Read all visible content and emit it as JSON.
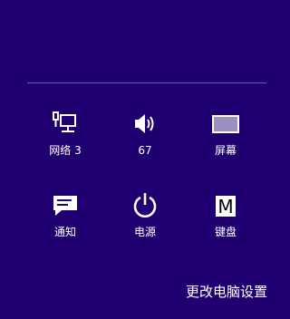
{
  "settings_panel": {
    "tiles": [
      {
        "name": "network",
        "label": "网络 3",
        "icon": "network-icon"
      },
      {
        "name": "volume",
        "label": "67",
        "icon": "speaker-icon"
      },
      {
        "name": "screen",
        "label": "屏幕",
        "icon": "screen-icon"
      },
      {
        "name": "notifications",
        "label": "通知",
        "icon": "notifications-icon"
      },
      {
        "name": "power",
        "label": "电源",
        "icon": "power-icon"
      },
      {
        "name": "keyboard",
        "label": "键盘",
        "icon": "keyboard-icon",
        "icon_text": "M"
      }
    ],
    "change_pc_settings_label": "更改电脑设置"
  },
  "colors": {
    "background": "#200070",
    "divider": "#6a5aae",
    "foreground": "#ffffff",
    "screen_fill": "#9c90c0"
  }
}
